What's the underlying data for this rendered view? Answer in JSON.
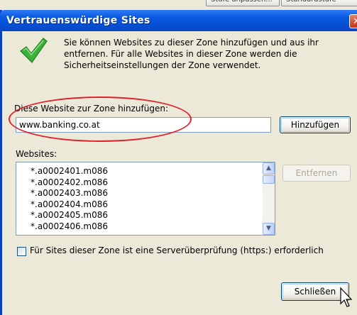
{
  "background": {
    "button_1": "Stufe anpassen...",
    "button_2": "Standardstufe"
  },
  "dialog": {
    "title": "Vertrauenswürdige Sites",
    "close_glyph": "✕",
    "info_text": "Sie können Websites zu dieser Zone hinzufügen und aus ihr entfernen. Für alle Websites in dieser Zone werden die Sicherheitseinstellungen der Zone verwendet.",
    "add_label": "Diese Website zur Zone hinzufügen:",
    "add_input_value": "www.banking.co.at",
    "add_button": "Hinzufügen",
    "websites_label": "Websites:",
    "websites": [
      "*.a0002401.m086",
      "*.a0002402.m086",
      "*.a0002403.m086",
      "*.a0002404.m086",
      "*.a0002405.m086",
      "*.a0002406.m086"
    ],
    "remove_button": "Entfernen",
    "https_checkbox_label": "Für Sites dieser Zone ist eine Serverüberprüfung (https:) erforderlich",
    "https_checked": false,
    "close_button": "Schließen"
  },
  "icons": {
    "check": "checkmark-icon",
    "close": "close-icon",
    "scroll_up": "arrow-up-icon",
    "scroll_down": "arrow-down-icon",
    "cursor": "mouse-pointer-icon"
  },
  "colors": {
    "titlebar": "#0a58e0",
    "dialog_bg": "#ece9d8",
    "highlight_ellipse": "#e0202a",
    "checkmark": "#3cb23a"
  }
}
